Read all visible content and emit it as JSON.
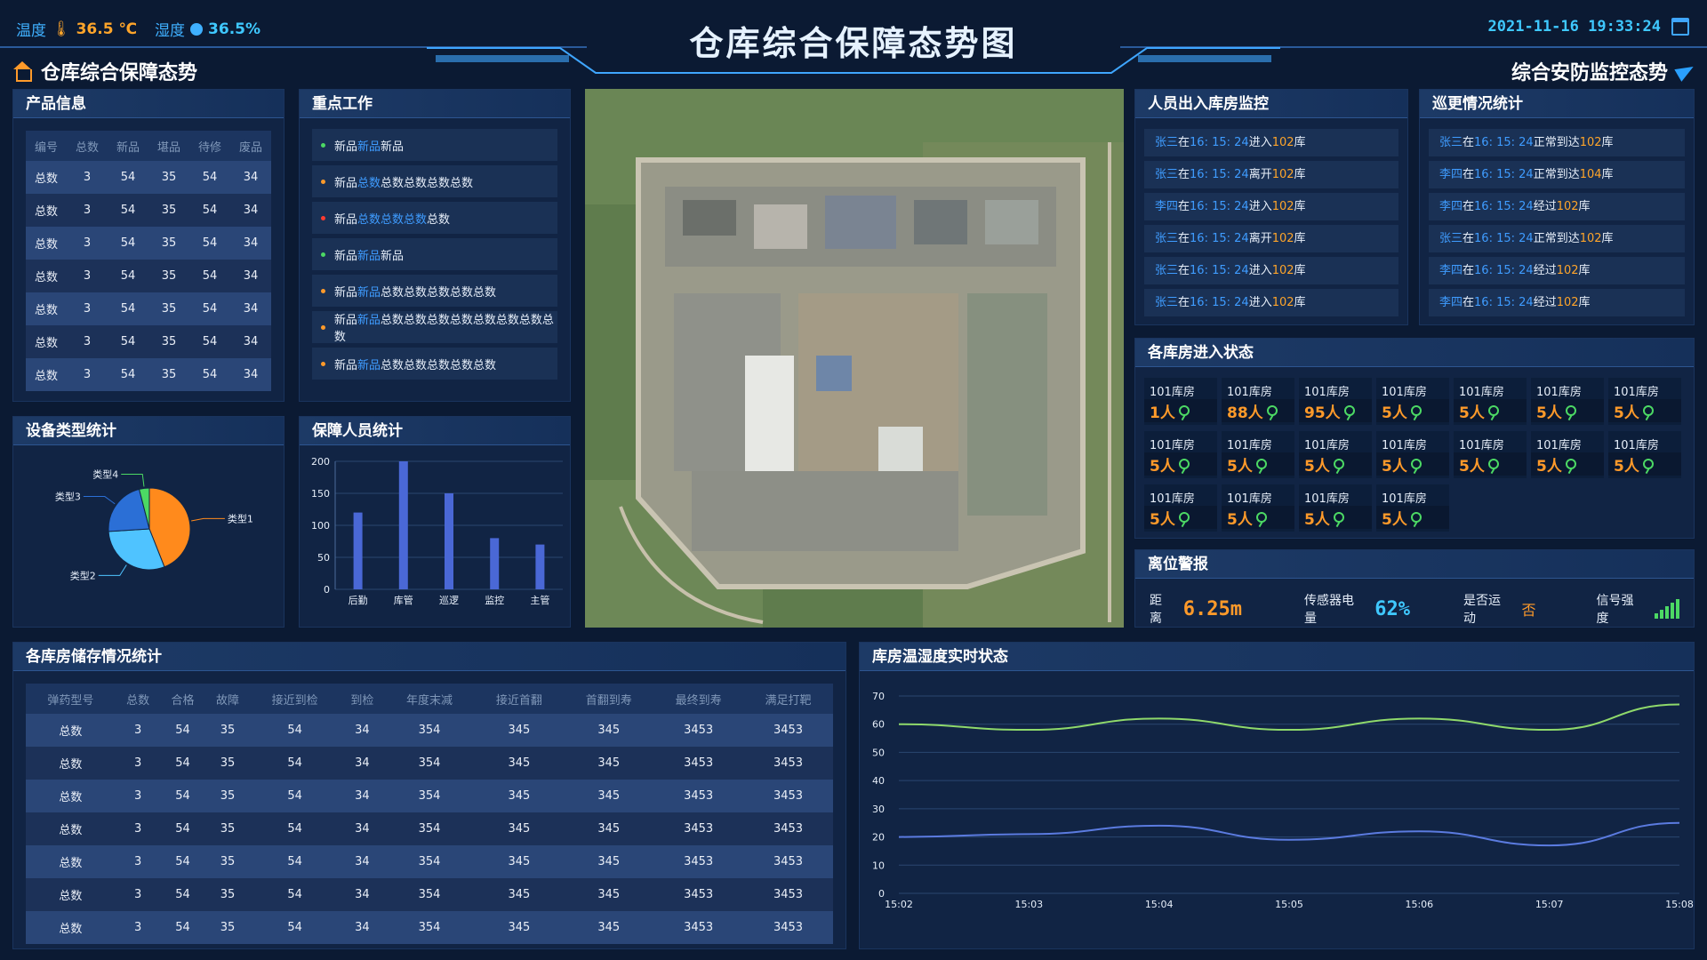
{
  "header": {
    "title": "仓库综合保障态势图",
    "temp_label": "温度",
    "temp_value": "36.5 ℃",
    "humidity_label": "湿度",
    "humidity_value": "36.5%",
    "datetime": "2021-11-16 19:33:24",
    "left_section": "仓库综合保障态势",
    "right_section": "综合安防监控态势"
  },
  "product_info": {
    "title": "产品信息",
    "columns": [
      "编号",
      "总数",
      "新品",
      "堪品",
      "待修",
      "废品"
    ],
    "rows": [
      [
        "总数",
        "3",
        "54",
        "35",
        "54",
        "34"
      ],
      [
        "总数",
        "3",
        "54",
        "35",
        "54",
        "34"
      ],
      [
        "总数",
        "3",
        "54",
        "35",
        "54",
        "34"
      ],
      [
        "总数",
        "3",
        "54",
        "35",
        "54",
        "34"
      ],
      [
        "总数",
        "3",
        "54",
        "35",
        "54",
        "34"
      ],
      [
        "总数",
        "3",
        "54",
        "35",
        "54",
        "34"
      ],
      [
        "总数",
        "3",
        "54",
        "35",
        "54",
        "34"
      ]
    ]
  },
  "key_work": {
    "title": "重点工作",
    "items": [
      {
        "a": "新品",
        "b": "新品",
        "c": "新品",
        "color": "#4cd964"
      },
      {
        "a": "新品",
        "b": "总数",
        "c": "总数总数总数总数",
        "color": "#ff9a2a"
      },
      {
        "a": "新品",
        "b": "总数总数总数",
        "c": "总数",
        "color": "#ff3b30"
      },
      {
        "a": "新品",
        "b": "新品",
        "c": "新品",
        "color": "#4cd964"
      },
      {
        "a": "新品",
        "b": "新品",
        "c": "总数总数总数总数总数",
        "color": "#ff9a2a"
      },
      {
        "a": "新品",
        "b": "新品",
        "c": "总数总数总数总数总数总数总数总数",
        "color": "#ff9a2a"
      },
      {
        "a": "新品",
        "b": "新品",
        "c": "总数总数总数总数总数",
        "color": "#ff9a2a"
      }
    ]
  },
  "personnel_monitor": {
    "title": "人员出入库房监控",
    "items": [
      {
        "name": "张三",
        "t1": "在",
        "time": "16: 15: 24",
        "action": "进入",
        "room": "102",
        "suffix": "库"
      },
      {
        "name": "张三",
        "t1": "在",
        "time": "16: 15: 24",
        "action": "离开",
        "room": "102",
        "suffix": "库"
      },
      {
        "name": "李四",
        "t1": "在",
        "time": "16: 15: 24",
        "action": "进入",
        "room": "102",
        "suffix": "库"
      },
      {
        "name": "张三",
        "t1": "在",
        "time": "16: 15: 24",
        "action": "离开",
        "room": "102",
        "suffix": "库"
      },
      {
        "name": "张三",
        "t1": "在",
        "time": "16: 15: 24",
        "action": "进入",
        "room": "102",
        "suffix": "库"
      },
      {
        "name": "张三",
        "t1": "在",
        "time": "16: 15: 24",
        "action": "进入",
        "room": "102",
        "suffix": "库"
      }
    ]
  },
  "patrol": {
    "title": "巡更情况统计",
    "items": [
      {
        "name": "张三",
        "t1": "在",
        "time": "16: 15: 24",
        "action": "正常到达",
        "room": "102",
        "suffix": "库"
      },
      {
        "name": "李四",
        "t1": "在",
        "time": "16: 15: 24",
        "action": "正常到达",
        "room": "104",
        "suffix": "库"
      },
      {
        "name": "李四",
        "t1": "在",
        "time": "16: 15: 24",
        "action": "经过",
        "room": "102",
        "suffix": "库"
      },
      {
        "name": "张三",
        "t1": "在",
        "time": "16: 15: 24",
        "action": "正常到达",
        "room": "102",
        "suffix": "库"
      },
      {
        "name": "李四",
        "t1": "在",
        "time": "16: 15: 24",
        "action": "经过",
        "room": "102",
        "suffix": "库"
      },
      {
        "name": "李四",
        "t1": "在",
        "time": "16: 15: 24",
        "action": "经过",
        "room": "102",
        "suffix": "库"
      }
    ]
  },
  "room_status": {
    "title": "各库房进入状态",
    "rooms": [
      {
        "name": "101库房",
        "value": "1人"
      },
      {
        "name": "101库房",
        "value": "88人"
      },
      {
        "name": "101库房",
        "value": "95人"
      },
      {
        "name": "101库房",
        "value": "5人"
      },
      {
        "name": "101库房",
        "value": "5人"
      },
      {
        "name": "101库房",
        "value": "5人"
      },
      {
        "name": "101库房",
        "value": "5人"
      },
      {
        "name": "101库房",
        "value": "5人"
      },
      {
        "name": "101库房",
        "value": "5人"
      },
      {
        "name": "101库房",
        "value": "5人"
      },
      {
        "name": "101库房",
        "value": "5人"
      },
      {
        "name": "101库房",
        "value": "5人"
      },
      {
        "name": "101库房",
        "value": "5人"
      },
      {
        "name": "101库房",
        "value": "5人"
      },
      {
        "name": "101库房",
        "value": "5人"
      },
      {
        "name": "101库房",
        "value": "5人"
      },
      {
        "name": "101库房",
        "value": "5人"
      },
      {
        "name": "101库房",
        "value": "5人"
      }
    ]
  },
  "alarm": {
    "title": "离位警报",
    "distance_label": "距离",
    "distance_value": "6.25m",
    "battery_label": "传感器电量",
    "battery_value": "62%",
    "motion_label": "是否运动",
    "motion_value": "否",
    "signal_label": "信号强度",
    "signal_level": 5
  },
  "device_chart": {
    "title": "设备类型统计",
    "chart_data": {
      "type": "pie",
      "labels": [
        "类型1",
        "类型2",
        "类型3",
        "类型4"
      ],
      "values": [
        44,
        30,
        22,
        4
      ],
      "colors": [
        "#ff8a1c",
        "#4fc3ff",
        "#2b6fd6",
        "#4cd964"
      ]
    }
  },
  "staff_chart": {
    "title": "保障人员统计",
    "chart_data": {
      "type": "bar",
      "categories": [
        "后勤",
        "库管",
        "巡逻",
        "监控",
        "主管"
      ],
      "values": [
        120,
        200,
        150,
        80,
        70
      ],
      "ylim": [
        0,
        200
      ],
      "yticks": [
        "0",
        "50",
        "100",
        "150",
        "200"
      ],
      "color": "#4a68d6"
    }
  },
  "storage": {
    "title": "各库房储存情况统计",
    "columns": [
      "弹药型号",
      "总数",
      "合格",
      "故障",
      "接近到检",
      "到检",
      "年度末减",
      "接近首翻",
      "首翻到寿",
      "最终到寿",
      "满足打靶"
    ],
    "rows": [
      [
        "总数",
        "3",
        "54",
        "35",
        "54",
        "34",
        "354",
        "345",
        "345",
        "3453",
        "3453"
      ],
      [
        "总数",
        "3",
        "54",
        "35",
        "54",
        "34",
        "354",
        "345",
        "345",
        "3453",
        "3453"
      ],
      [
        "总数",
        "3",
        "54",
        "35",
        "54",
        "34",
        "354",
        "345",
        "345",
        "3453",
        "3453"
      ],
      [
        "总数",
        "3",
        "54",
        "35",
        "54",
        "34",
        "354",
        "345",
        "345",
        "3453",
        "3453"
      ],
      [
        "总数",
        "3",
        "54",
        "35",
        "54",
        "34",
        "354",
        "345",
        "345",
        "3453",
        "3453"
      ],
      [
        "总数",
        "3",
        "54",
        "35",
        "54",
        "34",
        "354",
        "345",
        "345",
        "3453",
        "3453"
      ],
      [
        "总数",
        "3",
        "54",
        "35",
        "54",
        "34",
        "354",
        "345",
        "345",
        "3453",
        "3453"
      ]
    ]
  },
  "temp_chart": {
    "title": "库房温湿度实时状态",
    "chart_data": {
      "type": "line",
      "x": [
        "15:02",
        "15:03",
        "15:04",
        "15:05",
        "15:06",
        "15:07",
        "15:08"
      ],
      "ylim": [
        0,
        70
      ],
      "yticks": [
        "0",
        "10",
        "20",
        "30",
        "40",
        "50",
        "60",
        "70"
      ],
      "series": [
        {
          "values": [
            60,
            58,
            62,
            58,
            62,
            58,
            67
          ],
          "color": "#8fd96b"
        },
        {
          "values": [
            20,
            21,
            24,
            19,
            22,
            17,
            25
          ],
          "color": "#5b7be0"
        }
      ]
    }
  }
}
